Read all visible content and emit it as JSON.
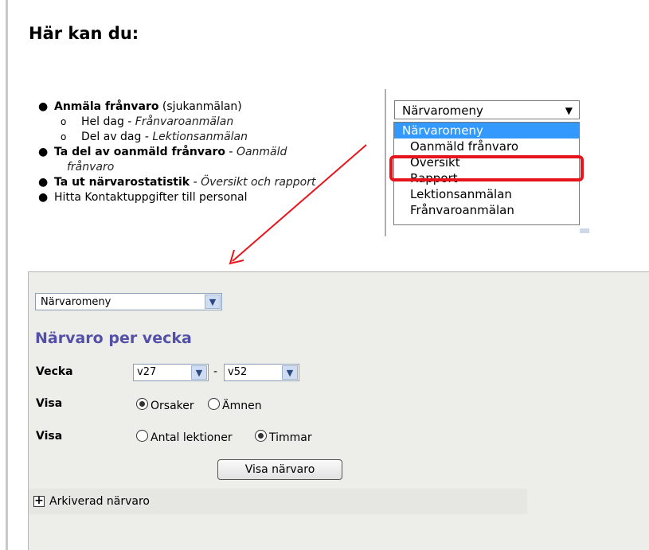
{
  "heading": "Här kan du:",
  "menu_list": {
    "item1_bold": "Anmäla frånvaro",
    "item1_rest": " (sjukanmälan)",
    "sub1_a": "Hel dag - ",
    "sub1_b": "Frånvaroanmälan",
    "sub2_a": "Del av dag - ",
    "sub2_b": "Lektionsanmälan",
    "item2_bold": "Ta del av oanmäld frånvaro",
    "item2_mid": " - ",
    "item2_italic_1": "Oanmäld",
    "item2_italic_2": "frånvaro",
    "item3_bold": "Ta ut närvarostatistik",
    "item3_mid": " - ",
    "item3_italic": "Översikt och rapport",
    "item4": "Hitta Kontaktuppgifter till personal",
    "bullet": "●",
    "circle": "o"
  },
  "dropdown": {
    "selected": "Närvaromeny",
    "arrow": "▼",
    "options": [
      "Närvaromeny",
      "Oanmäld frånvaro",
      "Översikt",
      "Rapport",
      "Lektionsanmälan",
      "Frånvaroanmälan"
    ],
    "highlighted_option": "Översikt"
  },
  "panel": {
    "menu_select": "Närvaromeny",
    "title": "Närvaro per vecka",
    "week_label": "Vecka",
    "week_from": "v27",
    "week_to": "v52",
    "dash": "-",
    "show_label_1": "Visa",
    "radio_causes": "Orsaker",
    "radio_subjects": "Ämnen",
    "show_label_2": "Visa",
    "radio_lessons": "Antal lektioner",
    "radio_hours": "Timmar",
    "submit": "Visa närvaro",
    "archived": "Arkiverad närvaro",
    "expand_symbol": "+"
  },
  "colors": {
    "highlight": "#e8141c",
    "title": "#5450a8",
    "selection": "#3399ff"
  }
}
